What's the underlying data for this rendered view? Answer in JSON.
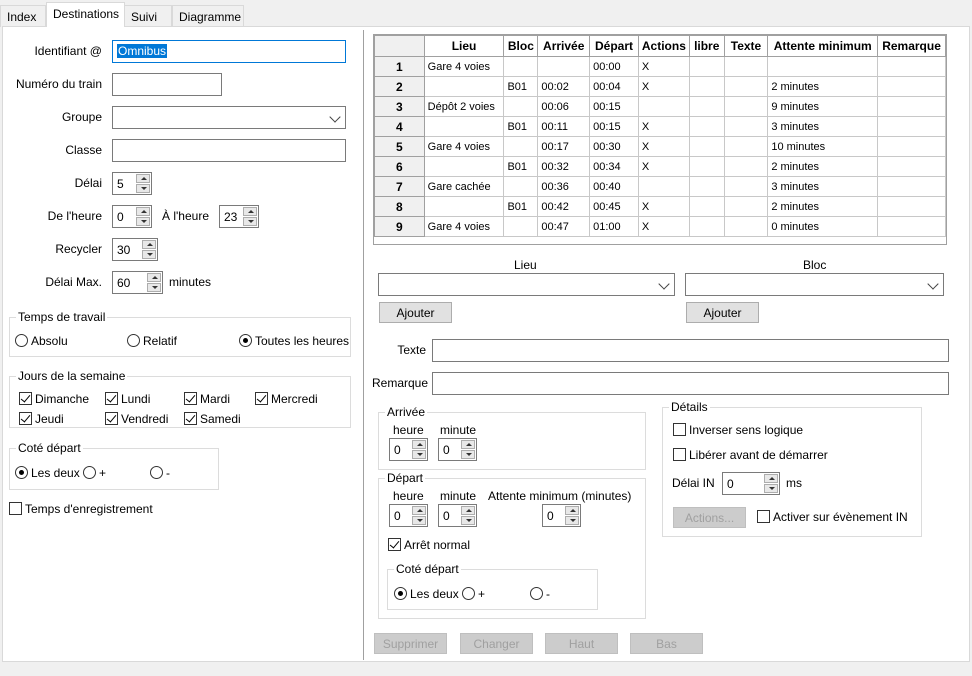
{
  "tabs": [
    "Index",
    "Destinations",
    "Suivi",
    "Diagramme"
  ],
  "left": {
    "identifiant_label": "Identifiant @",
    "identifiant_value": "Omnibus",
    "numero_label": "Numéro du train",
    "numero_value": "",
    "groupe_label": "Groupe",
    "groupe_value": "",
    "classe_label": "Classe",
    "classe_value": "",
    "delai_label": "Délai",
    "delai_value": "5",
    "de_heure_label": "De l'heure",
    "de_heure_value": "0",
    "a_heure_label": "À l'heure",
    "a_heure_value": "23",
    "recycler_label": "Recycler",
    "recycler_value": "30",
    "delai_max_label": "Délai Max.",
    "delai_max_value": "60",
    "minutes_label": "minutes",
    "temps_travail": {
      "title": "Temps de travail",
      "options": [
        "Absolu",
        "Relatif",
        "Toutes les heures"
      ],
      "selected": 2
    },
    "jours": {
      "title": "Jours de la semaine",
      "items": [
        "Dimanche",
        "Lundi",
        "Mardi",
        "Mercredi",
        "Jeudi",
        "Vendredi",
        "Samedi"
      ]
    },
    "cote_depart": {
      "title": "Coté départ",
      "options": [
        "Les deux",
        "+",
        "-"
      ]
    },
    "temps_enregistrement": "Temps d'enregistrement"
  },
  "table": {
    "headers": [
      "Lieu",
      "Bloc",
      "Arrivée",
      "Départ",
      "Actions",
      "libre",
      "Texte",
      "Attente minimum",
      "Remarque"
    ],
    "rows": [
      [
        "1",
        "Gare 4 voies",
        "",
        "",
        "00:00",
        "X",
        "",
        "",
        "",
        ""
      ],
      [
        "2",
        "",
        "B01",
        "00:02",
        "00:04",
        "X",
        "",
        "",
        "2 minutes",
        ""
      ],
      [
        "3",
        "Dépôt 2 voies",
        "",
        "00:06",
        "00:15",
        "",
        "",
        "",
        "9 minutes",
        ""
      ],
      [
        "4",
        "",
        "B01",
        "00:11",
        "00:15",
        "X",
        "",
        "",
        "3 minutes",
        ""
      ],
      [
        "5",
        "Gare 4 voies",
        "",
        "00:17",
        "00:30",
        "X",
        "",
        "",
        "10 minutes",
        ""
      ],
      [
        "6",
        "",
        "B01",
        "00:32",
        "00:34",
        "X",
        "",
        "",
        "2 minutes",
        ""
      ],
      [
        "7",
        "Gare cachée",
        "",
        "00:36",
        "00:40",
        "",
        "",
        "",
        "3 minutes",
        ""
      ],
      [
        "8",
        "",
        "B01",
        "00:42",
        "00:45",
        "X",
        "",
        "",
        "2 minutes",
        ""
      ],
      [
        "9",
        "Gare 4 voies",
        "",
        "00:47",
        "01:00",
        "X",
        "",
        "",
        "0 minutes",
        ""
      ]
    ]
  },
  "right": {
    "lieu_label": "Lieu",
    "bloc_label": "Bloc",
    "ajouter": "Ajouter",
    "texte_label": "Texte",
    "remarque_label": "Remarque",
    "arrivee": {
      "title": "Arrivée",
      "heure": "heure",
      "minute": "minute",
      "heure_value": "0",
      "minute_value": "0"
    },
    "depart": {
      "title": "Départ",
      "heure": "heure",
      "minute": "minute",
      "attente": "Attente minimum (minutes)",
      "heure_value": "0",
      "minute_value": "0",
      "attente_value": "0",
      "arret_normal": "Arrêt normal",
      "cote_title": "Coté départ",
      "cote_options": [
        "Les deux",
        "+",
        "-"
      ]
    },
    "details": {
      "title": "Détails",
      "inverser": "Inverser sens logique",
      "liberer": "Libérer avant de démarrer",
      "delai_in": "Délai IN",
      "delai_in_value": "0",
      "ms": "ms",
      "actions": "Actions...",
      "activer": "Activer sur évènement IN"
    },
    "buttons": [
      "Supprimer",
      "Changer",
      "Haut",
      "Bas"
    ]
  }
}
